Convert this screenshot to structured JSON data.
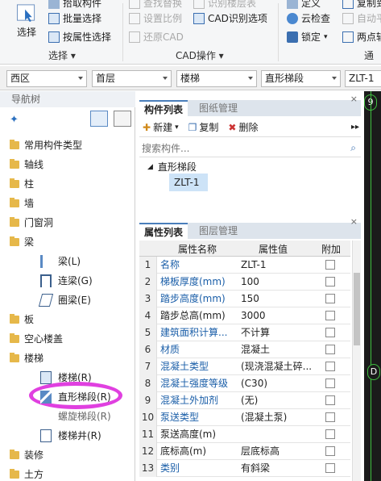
{
  "ribbon": {
    "select_label": "选择",
    "pick_label": "拾取构件",
    "batch_select": "批量选择",
    "attr_select": "按属性选择",
    "group_select": "选择",
    "find_replace": "查找替换",
    "set_ratio": "设置比例",
    "restore_cad": "还原CAD",
    "identify_floor": "识别楼层表",
    "cad_options": "CAD识别选项",
    "group_cad": "CAD操作",
    "define": "定义",
    "cloud_check": "云检查",
    "lock": "锁定",
    "copy_to": "复制到",
    "auto_balance": "自动平",
    "two_point": "两点辅",
    "group_common": "通用"
  },
  "combos": {
    "region": "西区",
    "floor": "首层",
    "category": "楼梯",
    "type": "直形梯段",
    "name": "ZLT-1"
  },
  "nav": {
    "title": "导航树",
    "items": [
      {
        "label": "常用构件类型"
      },
      {
        "label": "轴线"
      },
      {
        "label": "柱"
      },
      {
        "label": "墙"
      },
      {
        "label": "门窗洞"
      },
      {
        "label": "梁"
      },
      {
        "label": "梁(L)"
      },
      {
        "label": "连梁(G)"
      },
      {
        "label": "圈梁(E)"
      },
      {
        "label": "板"
      },
      {
        "label": "空心楼盖"
      },
      {
        "label": "楼梯"
      },
      {
        "label": "楼梯(R)"
      },
      {
        "label": "直形梯段(R)"
      },
      {
        "label": "螺旋梯段(R)"
      },
      {
        "label": "楼梯井(R)"
      },
      {
        "label": "装修"
      },
      {
        "label": "土方"
      }
    ]
  },
  "component_list": {
    "tab_active": "构件列表",
    "tab_inactive": "图纸管理",
    "new_label": "新建",
    "copy_label": "复制",
    "delete_label": "删除",
    "search_placeholder": "搜索构件...",
    "group": "直形梯段",
    "item": "ZLT-1"
  },
  "properties": {
    "tab_active": "属性列表",
    "tab_inactive": "图层管理",
    "headers": {
      "name": "属性名称",
      "value": "属性值",
      "extra": "附加"
    },
    "rows": [
      {
        "n": "1",
        "name": "名称",
        "value": "ZLT-1"
      },
      {
        "n": "2",
        "name": "梯板厚度(mm)",
        "value": "100"
      },
      {
        "n": "3",
        "name": "踏步高度(mm)",
        "value": "150"
      },
      {
        "n": "4",
        "name": "踏步总高(mm)",
        "value": "3000"
      },
      {
        "n": "5",
        "name": "建筑面积计算...",
        "value": "不计算"
      },
      {
        "n": "6",
        "name": "材质",
        "value": "混凝土"
      },
      {
        "n": "7",
        "name": "混凝土类型",
        "value": "(现浇混凝土碎..."
      },
      {
        "n": "8",
        "name": "混凝土强度等级",
        "value": "(C30)"
      },
      {
        "n": "9",
        "name": "混凝土外加剂",
        "value": "(无)"
      },
      {
        "n": "10",
        "name": "泵送类型",
        "value": "(混凝土泵)"
      },
      {
        "n": "11",
        "name": "泵送高度(m)",
        "value": ""
      },
      {
        "n": "12",
        "name": "底标高(m)",
        "value": "层底标高"
      },
      {
        "n": "13",
        "name": "类别",
        "value": "有斜梁"
      }
    ]
  },
  "canvas": {
    "label_top": "9",
    "label_mid": "D"
  },
  "colors": {
    "highlight": "#e040e0",
    "link": "#1a5ea8",
    "selected": "#cde3f7"
  }
}
